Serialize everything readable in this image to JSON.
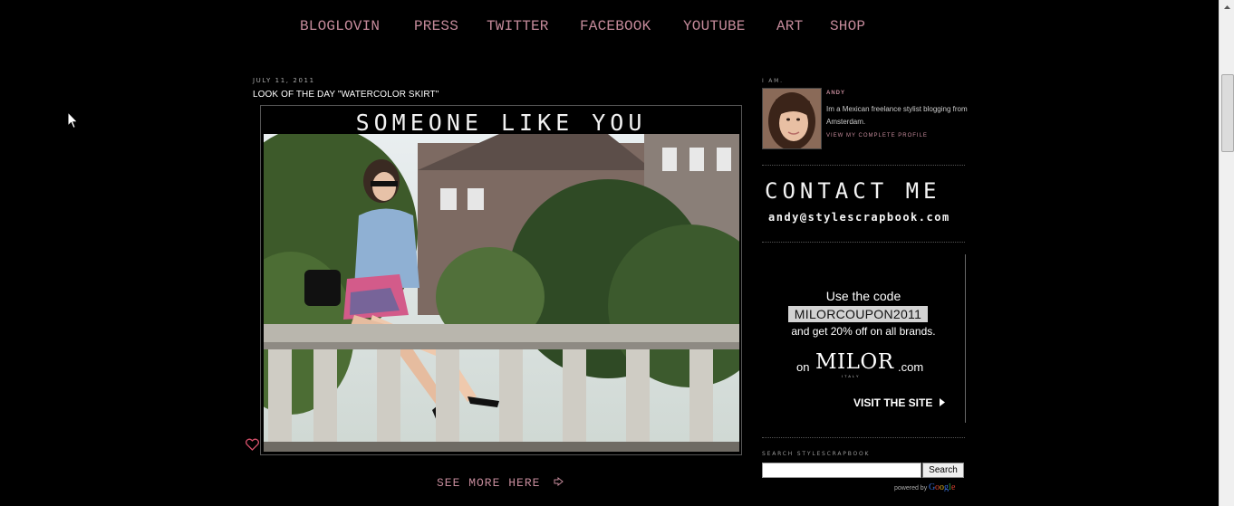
{
  "nav": {
    "items": [
      {
        "label": "BLOGLOVIN"
      },
      {
        "label": "PRESS"
      },
      {
        "label": "TWITTER"
      },
      {
        "label": "FACEBOOK"
      },
      {
        "label": "YOUTUBE"
      },
      {
        "label": "ART"
      },
      {
        "label": "SHOP"
      }
    ]
  },
  "post": {
    "date": "JULY 11, 2011",
    "title": "LOOK OF THE DAY \"WATERCOLOR SKIRT\"",
    "image_heading": "SOMEONE LIKE YOU",
    "see_more": "SEE MORE HERE",
    "heart_icon": "heart-outline-icon",
    "arrow_icon": "arrow-right-outline-icon"
  },
  "sidebar": {
    "profile": {
      "heading": "I AM.",
      "name": "ANDY",
      "bio": "Im a Mexican freelance stylist blogging from Amsterdam.",
      "link": "VIEW MY COMPLETE PROFILE"
    },
    "contact": {
      "title": "CONTACT ME",
      "email": "andy@stylescrapbook.com"
    },
    "ad": {
      "line1": "Use the code",
      "code": "MILORCOUPON2011",
      "line3": "and get 20% off on all brands.",
      "on": "on",
      "brand": "MILOR",
      "dotcom": ".com",
      "tagline": "ITALY",
      "cta": "VISIT THE SITE"
    },
    "search": {
      "heading": "SEARCH STYLESCRAPBOOK",
      "placeholder": "",
      "button": "Search",
      "powered_by": "powered by",
      "google": "Google"
    }
  },
  "colors": {
    "background": "#000000",
    "nav_link": "#c48a9a",
    "text": "#ffffff"
  }
}
